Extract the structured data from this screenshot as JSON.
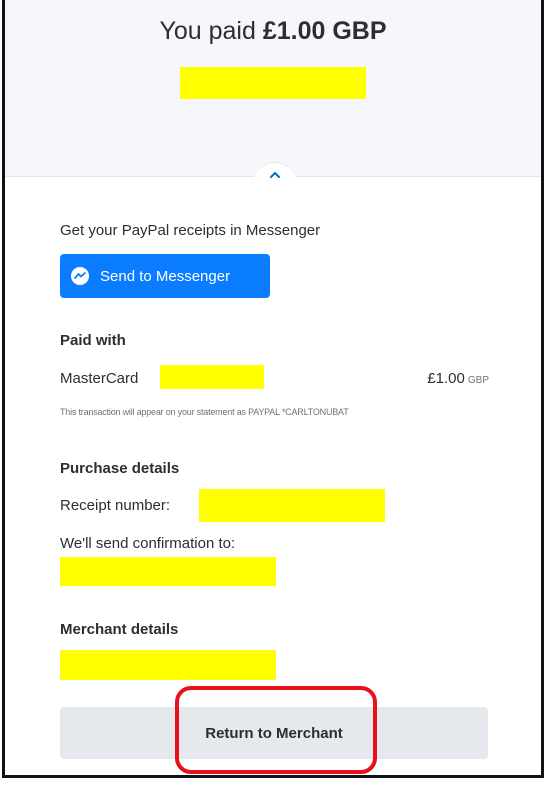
{
  "header": {
    "paid_prefix": "You paid ",
    "paid_amount": "£1.00 GBP"
  },
  "messenger": {
    "prompt": "Get your PayPal receipts in Messenger",
    "button_label": "Send to Messenger"
  },
  "paid_with": {
    "heading": "Paid with",
    "card_label": "MasterCard",
    "amount": "£1.00",
    "currency": "GBP",
    "statement_note": "This transaction will appear on your statement as PAYPAL *CARLTONUBAT"
  },
  "purchase": {
    "heading": "Purchase details",
    "receipt_label": "Receipt number:",
    "confirmation_label": "We'll send confirmation to:"
  },
  "merchant": {
    "heading": "Merchant details",
    "return_button": "Return to Merchant"
  },
  "colors": {
    "redaction": "#ffff00",
    "messenger_blue": "#0a7cff",
    "highlight_red": "#e8101a"
  }
}
